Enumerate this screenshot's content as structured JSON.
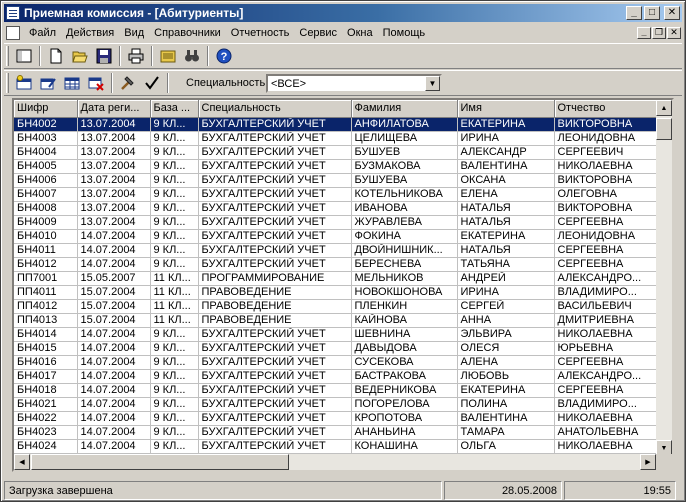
{
  "window": {
    "title": "Приемная комиссия - [Абитуриенты]"
  },
  "menu": [
    "Файл",
    "Действия",
    "Вид",
    "Справочники",
    "Отчетность",
    "Сервис",
    "Окна",
    "Помощь"
  ],
  "filter": {
    "label": "Специальность:",
    "value": "<ВСЕ>"
  },
  "grid": {
    "columns": [
      "Шифр",
      "Дата реги...",
      "База ...",
      "Специальность",
      "Фамилия",
      "Имя",
      "Отчество"
    ],
    "rows": [
      [
        "БН4002",
        "13.07.2004",
        "9 КЛ...",
        "БУХГАЛТЕРСКИЙ УЧЕТ",
        "АНФИЛАТОВА",
        "ЕКАТЕРИНА",
        "ВИКТОРОВНА"
      ],
      [
        "БН4003",
        "13.07.2004",
        "9 КЛ...",
        "БУХГАЛТЕРСКИЙ УЧЕТ",
        "ЦЕЛИЩЕВА",
        "ИРИНА",
        "ЛЕОНИДОВНА"
      ],
      [
        "БН4004",
        "13.07.2004",
        "9 КЛ...",
        "БУХГАЛТЕРСКИЙ УЧЕТ",
        "БУШУЕВ",
        "АЛЕКСАНДР",
        "СЕРГЕЕВИЧ"
      ],
      [
        "БН4005",
        "13.07.2004",
        "9 КЛ...",
        "БУХГАЛТЕРСКИЙ УЧЕТ",
        "БУЗМАКОВА",
        "ВАЛЕНТИНА",
        "НИКОЛАЕВНА"
      ],
      [
        "БН4006",
        "13.07.2004",
        "9 КЛ...",
        "БУХГАЛТЕРСКИЙ УЧЕТ",
        "БУШУЕВА",
        "ОКСАНА",
        "ВИКТОРОВНА"
      ],
      [
        "БН4007",
        "13.07.2004",
        "9 КЛ...",
        "БУХГАЛТЕРСКИЙ УЧЕТ",
        "КОТЕЛЬНИКОВА",
        "ЕЛЕНА",
        "ОЛЕГОВНА"
      ],
      [
        "БН4008",
        "13.07.2004",
        "9 КЛ...",
        "БУХГАЛТЕРСКИЙ УЧЕТ",
        "ИВАНОВА",
        "НАТАЛЬЯ",
        "ВИКТОРОВНА"
      ],
      [
        "БН4009",
        "13.07.2004",
        "9 КЛ...",
        "БУХГАЛТЕРСКИЙ УЧЕТ",
        "ЖУРАВЛЕВА",
        "НАТАЛЬЯ",
        "СЕРГЕЕВНА"
      ],
      [
        "БН4010",
        "14.07.2004",
        "9 КЛ...",
        "БУХГАЛТЕРСКИЙ УЧЕТ",
        "ФОКИНА",
        "ЕКАТЕРИНА",
        "ЛЕОНИДОВНА"
      ],
      [
        "БН4011",
        "14.07.2004",
        "9 КЛ...",
        "БУХГАЛТЕРСКИЙ УЧЕТ",
        "ДВОЙНИШНИК...",
        "НАТАЛЬЯ",
        "СЕРГЕЕВНА"
      ],
      [
        "БН4012",
        "14.07.2004",
        "9 КЛ...",
        "БУХГАЛТЕРСКИЙ УЧЕТ",
        "БЕРЕСНЕВА",
        "ТАТЬЯНА",
        "СЕРГЕЕВНА"
      ],
      [
        "ПП7001",
        "15.05.2007",
        "11 КЛ...",
        "ПРОГРАММИРОВАНИЕ",
        "МЕЛЬНИКОВ",
        "АНДРЕЙ",
        "АЛЕКСАНДРО..."
      ],
      [
        "ПП4011",
        "15.07.2004",
        "11 КЛ...",
        "ПРАВОВЕДЕНИЕ",
        "НОВОКШОНОВА",
        "ИРИНА",
        "ВЛАДИМИРО..."
      ],
      [
        "ПП4012",
        "15.07.2004",
        "11 КЛ...",
        "ПРАВОВЕДЕНИЕ",
        "ПЛЕНКИН",
        "СЕРГЕЙ",
        "ВАСИЛЬЕВИЧ"
      ],
      [
        "ПП4013",
        "15.07.2004",
        "11 КЛ...",
        "ПРАВОВЕДЕНИЕ",
        "КАЙНОВА",
        "АННА",
        "ДМИТРИЕВНА"
      ],
      [
        "БН4014",
        "14.07.2004",
        "9 КЛ...",
        "БУХГАЛТЕРСКИЙ УЧЕТ",
        "ШЕВНИНА",
        "ЭЛЬВИРА",
        "НИКОЛАЕВНА"
      ],
      [
        "БН4015",
        "14.07.2004",
        "9 КЛ...",
        "БУХГАЛТЕРСКИЙ УЧЕТ",
        "ДАВЫДОВА",
        "ОЛЕСЯ",
        "ЮРЬЕВНА"
      ],
      [
        "БН4016",
        "14.07.2004",
        "9 КЛ...",
        "БУХГАЛТЕРСКИЙ УЧЕТ",
        "СУСЕКОВА",
        "АЛЕНА",
        "СЕРГЕЕВНА"
      ],
      [
        "БН4017",
        "14.07.2004",
        "9 КЛ...",
        "БУХГАЛТЕРСКИЙ УЧЕТ",
        "БАСТРАКОВА",
        "ЛЮБОВЬ",
        "АЛЕКСАНДРО..."
      ],
      [
        "БН4018",
        "14.07.2004",
        "9 КЛ...",
        "БУХГАЛТЕРСКИЙ УЧЕТ",
        "ВЕДЕРНИКОВА",
        "ЕКАТЕРИНА",
        "СЕРГЕЕВНА"
      ],
      [
        "БН4021",
        "14.07.2004",
        "9 КЛ...",
        "БУХГАЛТЕРСКИЙ УЧЕТ",
        "ПОГОРЕЛОВА",
        "ПОЛИНА",
        "ВЛАДИМИРО..."
      ],
      [
        "БН4022",
        "14.07.2004",
        "9 КЛ...",
        "БУХГАЛТЕРСКИЙ УЧЕТ",
        "КРОПОТОВА",
        "ВАЛЕНТИНА",
        "НИКОЛАЕВНА"
      ],
      [
        "БН4023",
        "14.07.2004",
        "9 КЛ...",
        "БУХГАЛТЕРСКИЙ УЧЕТ",
        "АНАНЬИНА",
        "ТАМАРА",
        "АНАТОЛЬЕВНА"
      ],
      [
        "БН4024",
        "14.07.2004",
        "9 КЛ...",
        "БУХГАЛТЕРСКИЙ УЧЕТ",
        "КОНАШИНА",
        "ОЛЬГА",
        "НИКОЛАЕВНА"
      ]
    ]
  },
  "status": {
    "message": "Загрузка завершена",
    "date": "28.05.2008",
    "time": "19:55"
  },
  "colors": {
    "title_start": "#0a246a",
    "title_end": "#a6caf0",
    "selection": "#0a246a",
    "face": "#d4d0c8"
  }
}
